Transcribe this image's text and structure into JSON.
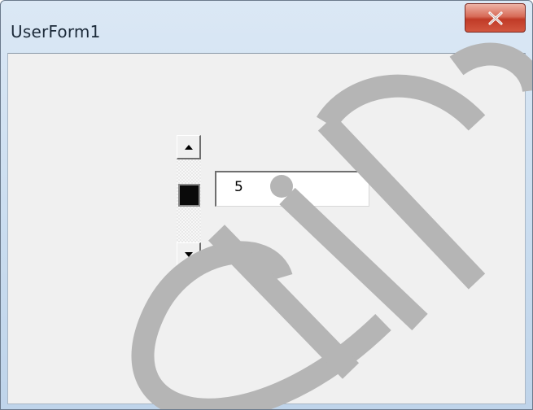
{
  "window": {
    "title": "UserForm1"
  },
  "close_button": {
    "glyph": "X",
    "icon": "close-icon"
  },
  "spin_button": {
    "up_icon": "arrow-up-icon",
    "down_icon": "arrow-down-icon"
  },
  "textbox": {
    "value": "5"
  },
  "colors": {
    "titlebar": "#c9dcef",
    "client_background": "#f0f0f0",
    "close_button": "#c94a36",
    "thumb": "#0a0a0a",
    "watermark": "#b5b5b5"
  }
}
